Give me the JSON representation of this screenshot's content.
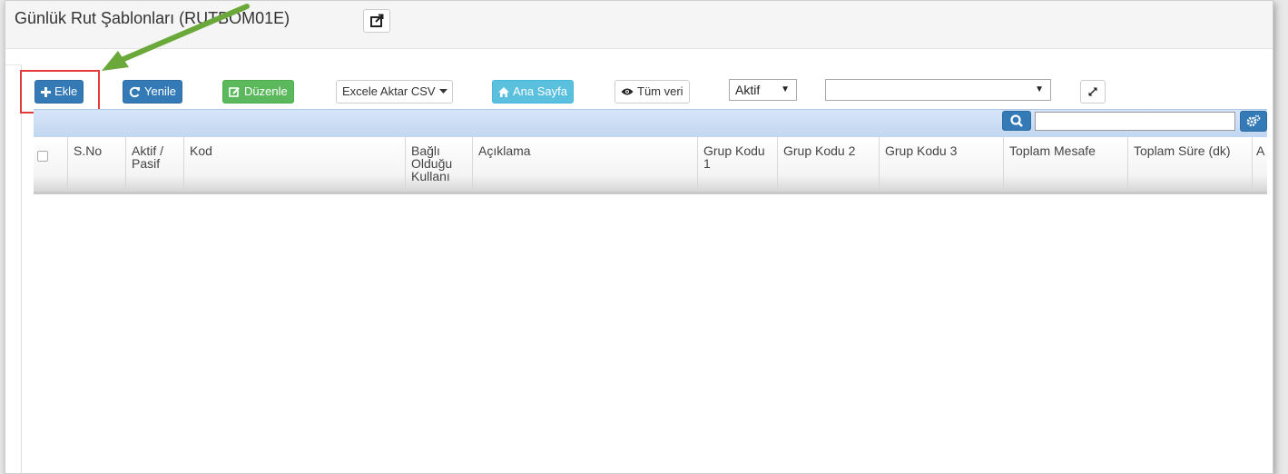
{
  "header": {
    "title": "Günlük Rut Şablonları (RUTBOM01E)"
  },
  "toolbar": {
    "add_label": "Ekle",
    "refresh_label": "Yenile",
    "edit_label": "Düzenle",
    "export_label": "Excele Aktar CSV",
    "home_label": "Ana Sayfa",
    "all_data_label": "Tüm veri",
    "status_selected": "Aktif",
    "filter_selected": ""
  },
  "grid": {
    "search_value": "",
    "columns": [
      "S.No",
      "Aktif / Pasif",
      "Kod",
      "Bağlı Olduğu Kullanı",
      "Açıklama",
      "Grup Kodu 1",
      "Grup Kodu 2",
      "Grup Kodu 3",
      "Toplam Mesafe",
      "Toplam Süre (dk)",
      "A"
    ]
  },
  "colors": {
    "primary": "#337ab7",
    "success": "#5cb85c",
    "info": "#5bc0de",
    "highlight_border": "#e33a3a",
    "arrow": "#6aa83a"
  }
}
